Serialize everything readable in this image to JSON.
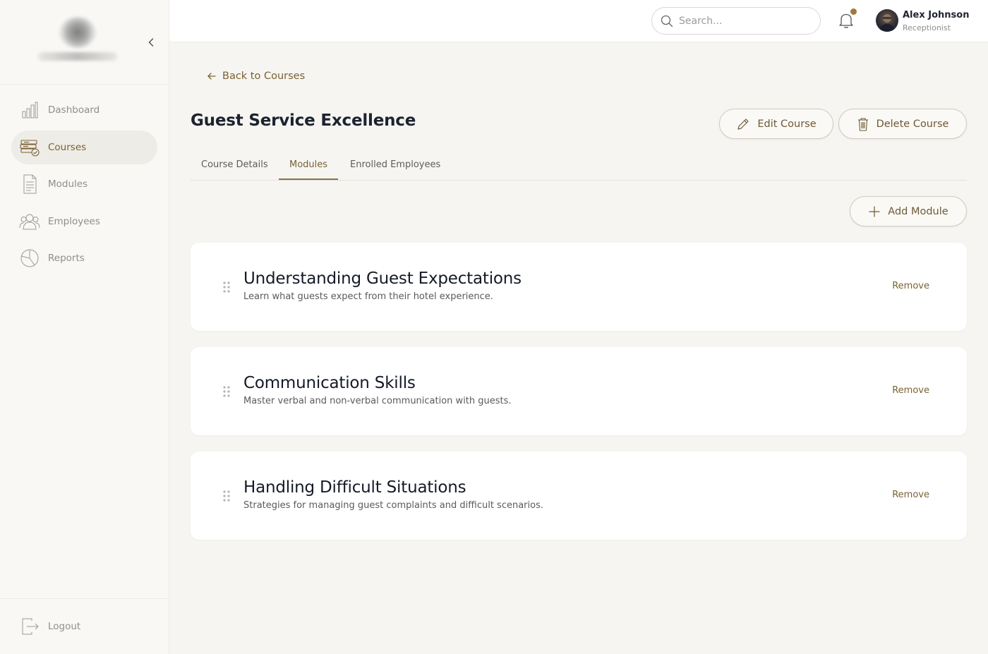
{
  "sidebar": {
    "items": [
      {
        "label": "Dashboard",
        "icon": "bar-chart-icon"
      },
      {
        "label": "Courses",
        "icon": "courses-icon"
      },
      {
        "label": "Modules",
        "icon": "document-icon"
      },
      {
        "label": "Employees",
        "icon": "users-icon"
      },
      {
        "label": "Reports",
        "icon": "pie-chart-icon"
      }
    ],
    "active": "Courses",
    "logout_label": "Logout"
  },
  "header": {
    "search_placeholder": "Search...",
    "user_name": "Alex Johnson",
    "user_role": "Receptionist",
    "notification_dot_color": "#9b7a3e"
  },
  "main": {
    "back_label": "Back to Courses",
    "title": "Guest Service Excellence",
    "edit_label": "Edit Course",
    "delete_label": "Delete Course",
    "tabs": [
      "Course Details",
      "Modules",
      "Enrolled Employees"
    ],
    "active_tab": "Modules",
    "add_module_label": "Add Module",
    "modules": [
      {
        "title": "Understanding Guest Expectations",
        "description": "Learn what guests expect from their hotel experience.",
        "remove_label": "Remove"
      },
      {
        "title": "Communication Skills",
        "description": "Master verbal and non-verbal communication with guests.",
        "remove_label": "Remove"
      },
      {
        "title": "Handling Difficult Situations",
        "description": "Strategies for managing guest complaints and difficult scenarios.",
        "remove_label": "Remove"
      }
    ]
  },
  "colors": {
    "accent": "#7a6235",
    "background": "#f6f5f1",
    "card": "#ffffff"
  }
}
